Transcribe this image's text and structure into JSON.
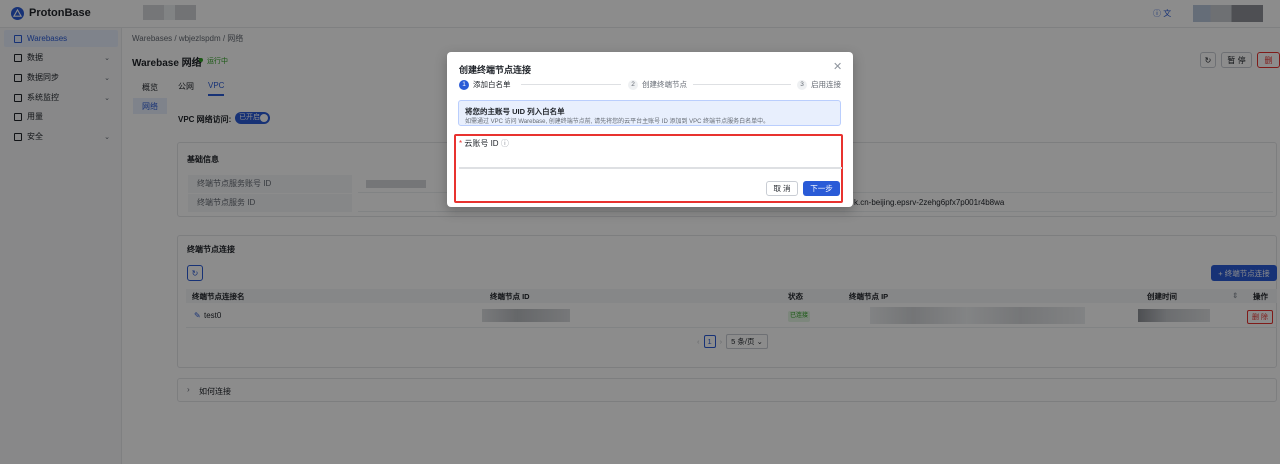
{
  "app": {
    "name": "ProtonBase",
    "help_label": "文"
  },
  "sidebar": {
    "items": [
      {
        "label": "Warebases",
        "active": true
      },
      {
        "label": "数据",
        "chevron": true
      },
      {
        "label": "数据同步",
        "chevron": true
      },
      {
        "label": "系统监控",
        "chevron": true
      },
      {
        "label": "用量"
      },
      {
        "label": "安全",
        "chevron": true
      }
    ]
  },
  "breadcrumb": "Warebases / wbjezlspdm / 网络",
  "page": {
    "title": "Warebase 网络",
    "status": "运行中",
    "pause_label": "暂 停",
    "delete_label": "删"
  },
  "side_tabs": [
    "概览",
    "网络"
  ],
  "top_tabs": [
    {
      "label": "公网"
    },
    {
      "label": "VPC",
      "active": true
    }
  ],
  "vpc": {
    "label": "VPC 网络访问:",
    "toggle": "已开启"
  },
  "basic": {
    "title": "基础信息",
    "rows": [
      {
        "label": "终端节点服务账号 ID",
        "value": ""
      },
      {
        "label": "终端节点服务 ID",
        "value": "k.cn-beijing.epsrv-2zehg6pfx7p001r4b8wa"
      }
    ]
  },
  "endpoints": {
    "title": "终端节点连接",
    "add_label": "+ 终端节点连接",
    "columns": [
      "终端节点连接名",
      "终端节点 ID",
      "状态",
      "终端节点 IP",
      "创建时间",
      "操作"
    ],
    "rows": [
      {
        "name": "test0",
        "status": "已连接",
        "action": "删 除"
      }
    ],
    "page": "1",
    "page_size": "5 条/页"
  },
  "howto": {
    "label": "如何连接"
  },
  "modal": {
    "title": "创建终端节点连接",
    "steps": [
      {
        "num": "1",
        "label": "添加白名单",
        "active": true
      },
      {
        "num": "2",
        "label": "创建终端节点"
      },
      {
        "num": "3",
        "label": "启用连接"
      }
    ],
    "notice_title": "将您的主账号 UID 列入白名单",
    "notice_desc": "如需通过 VPC 访问 Warebase, 创建终端节点前, 请先将您的云平台主账号 ID 添加到 VPC 终端节点服务白名单中。",
    "field_label": "云账号 ID",
    "field_value": "",
    "cancel_label": "取 消",
    "next_label": "下一步"
  },
  "colors": {
    "accent": "#2a5bd7",
    "danger": "#e8322f",
    "success": "#2ea121"
  }
}
